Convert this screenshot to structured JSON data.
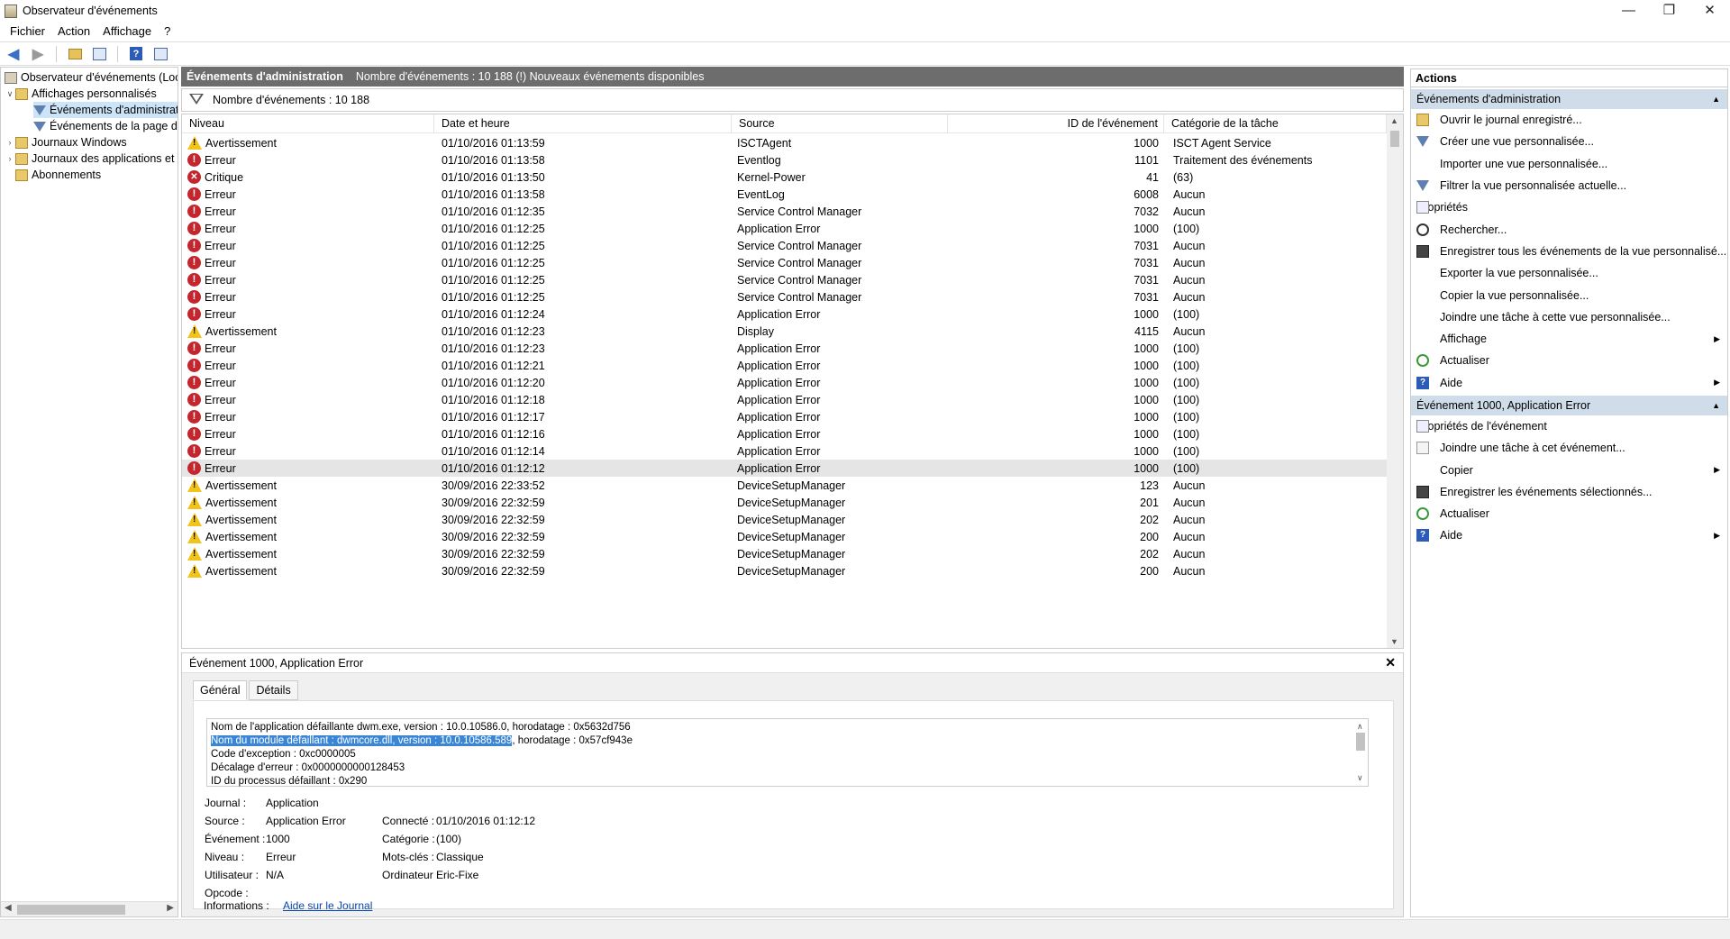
{
  "window": {
    "title": "Observateur d'événements"
  },
  "menu": [
    "Fichier",
    "Action",
    "Affichage",
    "?"
  ],
  "tree": {
    "root": "Observateur d'événements (Local)",
    "custom_views": "Affichages personnalisés",
    "admin_events": "Événements d'administration",
    "page_events": "Événements de la page d'accueil",
    "windows_logs": "Journaux Windows",
    "app_logs": "Journaux des applications et services",
    "subscriptions": "Abonnements"
  },
  "header": {
    "title": "Événements d'administration",
    "info": "Nombre d'événements : 10 188 (!) Nouveaux événements disponibles"
  },
  "filter": {
    "text": "Nombre d'événements : 10 188"
  },
  "columns": [
    "Niveau",
    "Date et heure",
    "Source",
    "ID de l'événement",
    "Catégorie de la tâche"
  ],
  "events": [
    {
      "icon": "warn",
      "level": "Avertissement",
      "date": "01/10/2016 01:13:59",
      "source": "ISCTAgent",
      "id": "1000",
      "cat": "ISCT Agent Service"
    },
    {
      "icon": "err",
      "level": "Erreur",
      "date": "01/10/2016 01:13:58",
      "source": "Eventlog",
      "id": "1101",
      "cat": "Traitement des événements"
    },
    {
      "icon": "crit",
      "level": "Critique",
      "date": "01/10/2016 01:13:50",
      "source": "Kernel-Power",
      "id": "41",
      "cat": "(63)"
    },
    {
      "icon": "err",
      "level": "Erreur",
      "date": "01/10/2016 01:13:58",
      "source": "EventLog",
      "id": "6008",
      "cat": "Aucun"
    },
    {
      "icon": "err",
      "level": "Erreur",
      "date": "01/10/2016 01:12:35",
      "source": "Service Control Manager",
      "id": "7032",
      "cat": "Aucun"
    },
    {
      "icon": "err",
      "level": "Erreur",
      "date": "01/10/2016 01:12:25",
      "source": "Application Error",
      "id": "1000",
      "cat": "(100)"
    },
    {
      "icon": "err",
      "level": "Erreur",
      "date": "01/10/2016 01:12:25",
      "source": "Service Control Manager",
      "id": "7031",
      "cat": "Aucun"
    },
    {
      "icon": "err",
      "level": "Erreur",
      "date": "01/10/2016 01:12:25",
      "source": "Service Control Manager",
      "id": "7031",
      "cat": "Aucun"
    },
    {
      "icon": "err",
      "level": "Erreur",
      "date": "01/10/2016 01:12:25",
      "source": "Service Control Manager",
      "id": "7031",
      "cat": "Aucun"
    },
    {
      "icon": "err",
      "level": "Erreur",
      "date": "01/10/2016 01:12:25",
      "source": "Service Control Manager",
      "id": "7031",
      "cat": "Aucun"
    },
    {
      "icon": "err",
      "level": "Erreur",
      "date": "01/10/2016 01:12:24",
      "source": "Application Error",
      "id": "1000",
      "cat": "(100)"
    },
    {
      "icon": "warn",
      "level": "Avertissement",
      "date": "01/10/2016 01:12:23",
      "source": "Display",
      "id": "4115",
      "cat": "Aucun"
    },
    {
      "icon": "err",
      "level": "Erreur",
      "date": "01/10/2016 01:12:23",
      "source": "Application Error",
      "id": "1000",
      "cat": "(100)"
    },
    {
      "icon": "err",
      "level": "Erreur",
      "date": "01/10/2016 01:12:21",
      "source": "Application Error",
      "id": "1000",
      "cat": "(100)"
    },
    {
      "icon": "err",
      "level": "Erreur",
      "date": "01/10/2016 01:12:20",
      "source": "Application Error",
      "id": "1000",
      "cat": "(100)"
    },
    {
      "icon": "err",
      "level": "Erreur",
      "date": "01/10/2016 01:12:18",
      "source": "Application Error",
      "id": "1000",
      "cat": "(100)"
    },
    {
      "icon": "err",
      "level": "Erreur",
      "date": "01/10/2016 01:12:17",
      "source": "Application Error",
      "id": "1000",
      "cat": "(100)"
    },
    {
      "icon": "err",
      "level": "Erreur",
      "date": "01/10/2016 01:12:16",
      "source": "Application Error",
      "id": "1000",
      "cat": "(100)"
    },
    {
      "icon": "err",
      "level": "Erreur",
      "date": "01/10/2016 01:12:14",
      "source": "Application Error",
      "id": "1000",
      "cat": "(100)"
    },
    {
      "icon": "err",
      "level": "Erreur",
      "date": "01/10/2016 01:12:12",
      "source": "Application Error",
      "id": "1000",
      "cat": "(100)",
      "selected": true
    },
    {
      "icon": "warn",
      "level": "Avertissement",
      "date": "30/09/2016 22:33:52",
      "source": "DeviceSetupManager",
      "id": "123",
      "cat": "Aucun"
    },
    {
      "icon": "warn",
      "level": "Avertissement",
      "date": "30/09/2016 22:32:59",
      "source": "DeviceSetupManager",
      "id": "201",
      "cat": "Aucun"
    },
    {
      "icon": "warn",
      "level": "Avertissement",
      "date": "30/09/2016 22:32:59",
      "source": "DeviceSetupManager",
      "id": "202",
      "cat": "Aucun"
    },
    {
      "icon": "warn",
      "level": "Avertissement",
      "date": "30/09/2016 22:32:59",
      "source": "DeviceSetupManager",
      "id": "200",
      "cat": "Aucun"
    },
    {
      "icon": "warn",
      "level": "Avertissement",
      "date": "30/09/2016 22:32:59",
      "source": "DeviceSetupManager",
      "id": "202",
      "cat": "Aucun"
    },
    {
      "icon": "warn",
      "level": "Avertissement",
      "date": "30/09/2016 22:32:59",
      "source": "DeviceSetupManager",
      "id": "200",
      "cat": "Aucun"
    }
  ],
  "detail": {
    "title": "Événement 1000, Application Error",
    "tabs": [
      "Général",
      "Détails"
    ],
    "desc": {
      "line1": "Nom de l'application défaillante dwm.exe, version : 10.0.10586.0, horodatage : 0x5632d756",
      "line2_hl": "Nom du module défaillant : dwmcore.dll, version : 10.0.10586.589",
      "line2_rest": ", horodatage : 0x57cf943e",
      "line3": "Code d'exception : 0xc0000005",
      "line4": "Décalage d'erreur : 0x0000000000128453",
      "line5": "ID du processus défaillant : 0x290"
    },
    "labels": {
      "journal": "Journal :",
      "source": "Source :",
      "evenement": "Événement :",
      "niveau": "Niveau :",
      "utilisateur": "Utilisateur :",
      "opcode": "Opcode :",
      "informations": "Informations :",
      "connecte": "Connecté :",
      "categorie": "Catégorie :",
      "motscles": "Mots-clés :",
      "ordinateur": "Ordinateur :"
    },
    "values": {
      "journal": "Application",
      "source": "Application Error",
      "evenement": "1000",
      "niveau": "Erreur",
      "utilisateur": "N/A",
      "informations": "Aide sur le Journal",
      "connecte": "01/10/2016 01:12:12",
      "categorie": "(100)",
      "motscles": "Classique",
      "ordinateur": "Eric-Fixe"
    }
  },
  "actions": {
    "title": "Actions",
    "section1": "Événements d'administration",
    "items1": [
      {
        "icon": "folder",
        "label": "Ouvrir le journal enregistré..."
      },
      {
        "icon": "filter",
        "label": "Créer une vue personnalisée..."
      },
      {
        "icon": "none",
        "label": "Importer une vue personnalisée..."
      },
      {
        "icon": "filter",
        "label": "Filtrer la vue personnalisée actuelle..."
      },
      {
        "icon": "prop",
        "label": "Propriétés"
      },
      {
        "icon": "find",
        "label": "Rechercher..."
      },
      {
        "icon": "save",
        "label": "Enregistrer tous les événements de la vue personnalisé..."
      },
      {
        "icon": "none",
        "label": "Exporter la vue personnalisée..."
      },
      {
        "icon": "none",
        "label": "Copier la vue personnalisée..."
      },
      {
        "icon": "none",
        "label": "Joindre une tâche à cette vue personnalisée..."
      },
      {
        "icon": "none",
        "label": "Affichage",
        "sub": true
      },
      {
        "icon": "refresh",
        "label": "Actualiser"
      },
      {
        "icon": "help",
        "label": "Aide",
        "sub": true
      }
    ],
    "section2": "Événement 1000, Application Error",
    "items2": [
      {
        "icon": "prop",
        "label": "Propriétés de l'événement"
      },
      {
        "icon": "task",
        "label": "Joindre une tâche à cet événement..."
      },
      {
        "icon": "none",
        "label": "Copier",
        "sub": true
      },
      {
        "icon": "save",
        "label": "Enregistrer les événements sélectionnés..."
      },
      {
        "icon": "refresh",
        "label": "Actualiser"
      },
      {
        "icon": "help",
        "label": "Aide",
        "sub": true
      }
    ]
  }
}
